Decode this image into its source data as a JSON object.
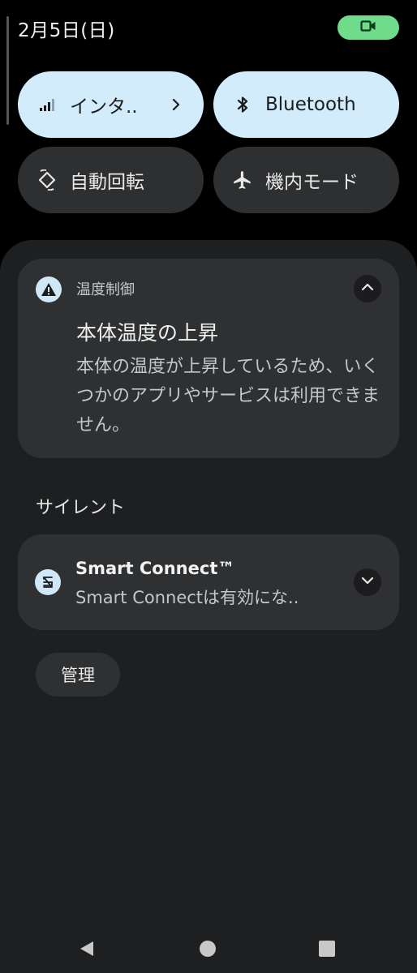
{
  "status_bar": {
    "date": "2月5日(日)",
    "record_icon": "videocam-icon",
    "record_pill_color": "#6fdc8c"
  },
  "quick_tiles": [
    {
      "label": "インタ..",
      "icon": "signal-icon",
      "active": true,
      "has_chevron": true
    },
    {
      "label": "Bluetooth",
      "icon": "bluetooth-icon",
      "active": true,
      "has_chevron": false
    },
    {
      "label": "自動回転",
      "icon": "auto-rotate-icon",
      "active": false,
      "has_chevron": false
    },
    {
      "label": "機内モード",
      "icon": "airplane-icon",
      "active": false,
      "has_chevron": false
    }
  ],
  "notifications": {
    "thermal": {
      "app_name": "温度制御",
      "title": "本体温度の上昇",
      "body": "本体の温度が上昇しているため、いくつかのアプリやサービスは利用できません。",
      "icon": "warning-icon",
      "expand_icon": "chevron-up-icon"
    },
    "silent_section_label": "サイレント",
    "smart_connect": {
      "title": "Smart Connect™",
      "text": "Smart Connectは有効にな..",
      "icon": "smart-connect-icon",
      "expand_icon": "chevron-down-icon"
    }
  },
  "manage_button": "管理",
  "nav_bar": {
    "back_icon": "back-triangle-icon",
    "home_icon": "home-circle-icon",
    "recents_icon": "recents-square-icon"
  },
  "colors": {
    "tile_active": "#d3ecfb",
    "tile_inactive": "#2d2f31",
    "shade_bg": "#1e1f21",
    "card_bg": "#2e3032"
  }
}
